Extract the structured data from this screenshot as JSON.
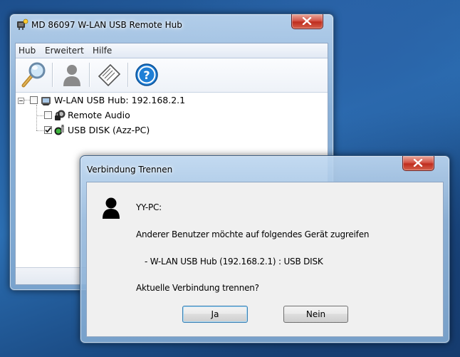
{
  "main_window": {
    "title": "MD 86097 W-LAN USB Remote Hub",
    "menu": [
      "Hub",
      "Erweitert",
      "Hilfe"
    ],
    "toolbar_icons": [
      "search-icon",
      "user-icon",
      "certificate-icon",
      "help-icon"
    ],
    "tree": {
      "root_label": "W-LAN USB Hub: 192.168.2.1",
      "children": [
        {
          "label": "Remote Audio",
          "checked": false
        },
        {
          "label": "USB DISK (Azz-PC)",
          "checked": true
        }
      ]
    }
  },
  "dialog": {
    "title": "Verbindung Trennen",
    "user_line": "YY-PC:",
    "message": "Anderer Benutzer möchte auf folgendes Gerät zugreifen",
    "device_line": "- W-LAN USB Hub (192.168.2.1) : USB DISK",
    "question": "Aktuelle Verbindung trennen?",
    "yes_label": "Ja",
    "no_label": "Nein"
  },
  "colors": {
    "close_button": "#c8382a",
    "desktop": "#1d4f8d",
    "accent": "#3c7fb1"
  }
}
